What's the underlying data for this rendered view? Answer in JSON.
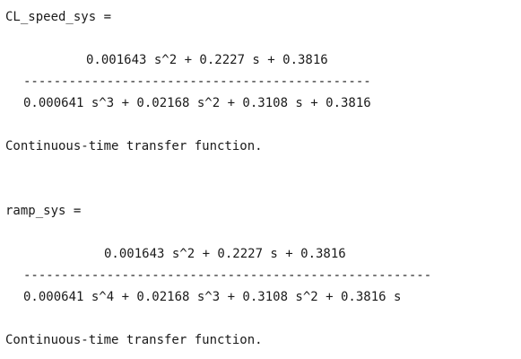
{
  "output": {
    "blocks": [
      {
        "var_header": "CL_speed_sys =",
        "numerator": "0.001643 s^2 + 0.2227 s + 0.3816",
        "divider": "----------------------------------------------",
        "denominator": "0.000641 s^3 + 0.02168 s^2 + 0.3108 s + 0.3816",
        "type_text": "Continuous-time transfer function."
      },
      {
        "var_header": "ramp_sys =",
        "numerator": "0.001643 s^2 + 0.2227 s + 0.3816",
        "divider": "------------------------------------------------------",
        "denominator": "0.000641 s^4 + 0.02168 s^3 + 0.3108 s^2 + 0.3816 s",
        "type_text": "Continuous-time transfer function."
      }
    ]
  }
}
